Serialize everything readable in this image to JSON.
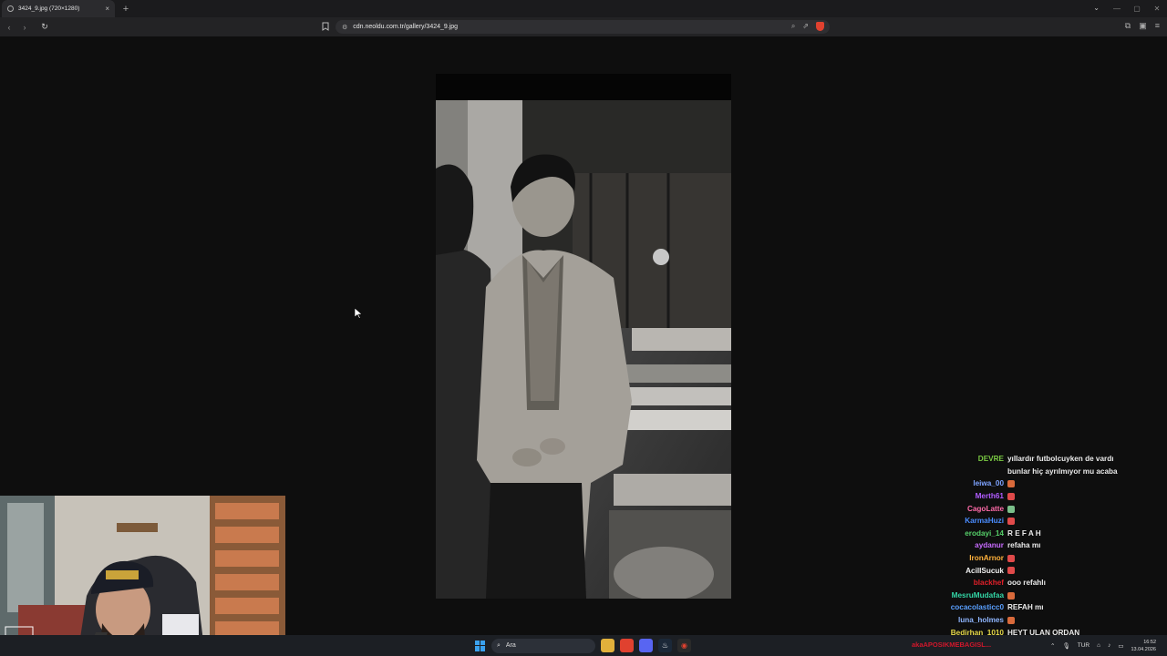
{
  "browser": {
    "tab_title": "3424_9.jpg (720×1280)",
    "tab_close": "×",
    "new_tab": "+",
    "url": "cdn.neoldu.com.tr/gallery/3424_9.jpg",
    "window_minimize": "—",
    "window_maximize": "▢",
    "window_close": "✕"
  },
  "chat": {
    "messages": [
      {
        "user": "DEVRE",
        "color": "#7ac943",
        "text": "yıllardır futbolcuyken de vardı",
        "emote": ""
      },
      {
        "user": "",
        "color": "#7ac943",
        "text": "bunlar hiç ayrılmıyor mu acaba",
        "emote": ""
      },
      {
        "user": "leiwa_00",
        "color": "#7ea3ff",
        "text": "",
        "emote": "#d96a3b"
      },
      {
        "user": "Merth61",
        "color": "#b15cff",
        "text": "",
        "emote": "#e04a4a"
      },
      {
        "user": "CagoLatte",
        "color": "#ff6ba9",
        "text": "",
        "emote": "#7bbf8a"
      },
      {
        "user": "KarmaHuzi",
        "color": "#4a8cff",
        "text": "",
        "emote": "#e04a4a"
      },
      {
        "user": "erodayi_14",
        "color": "#56d06a",
        "text": "R E F A H",
        "emote": ""
      },
      {
        "user": "aydanur",
        "color": "#c86bff",
        "text": "refaha mı",
        "emote": ""
      },
      {
        "user": "IronArnor",
        "color": "#ffb13b",
        "text": "",
        "emote": "#e04a4a"
      },
      {
        "user": "AcilISucuk",
        "color": "#f2f2f2",
        "text": "",
        "emote": "#e04a4a"
      },
      {
        "user": "blackhef",
        "color": "#e0202a",
        "text": "ooo refahlı",
        "emote": ""
      },
      {
        "user": "MesruMudafaa",
        "color": "#33d6a6",
        "text": "",
        "emote": "#d96a3b"
      },
      {
        "user": "cocacolasticc0",
        "color": "#5aa0ff",
        "text": "REFAH mı",
        "emote": ""
      },
      {
        "user": "luna_holmes",
        "color": "#8fb6ff",
        "text": "",
        "emote": "#d96a3b"
      },
      {
        "user": "Bedirhan_1010",
        "color": "#e6d94a",
        "text": "HEYT ULAN ORDAN",
        "emote": ""
      }
    ]
  },
  "taskbar": {
    "search_placeholder": "Ara",
    "overlay_text": "akaAPOSIKMEBAGISL...",
    "language": "TUR",
    "time": "16:52",
    "date": "13.04.2026"
  }
}
